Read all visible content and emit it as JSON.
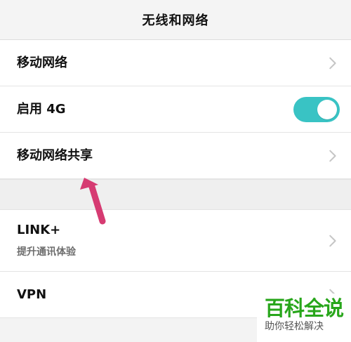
{
  "header": {
    "title": "无线和网络"
  },
  "items": [
    {
      "label": "移动网络",
      "control": "chevron-right-icon"
    },
    {
      "label": "启用 4G",
      "control": "toggle",
      "toggle_on": true,
      "toggle_color": "#39c3c4"
    },
    {
      "label": "移动网络共享",
      "control": "chevron-right-icon"
    },
    {
      "label": "LINK+",
      "sublabel": "提升通讯体验",
      "control": "chevron-right-icon"
    },
    {
      "label": "VPN",
      "control": "chevron-right-icon"
    }
  ],
  "annotation": {
    "color": "#d63b72",
    "icon": "pointer-arrow-icon"
  },
  "watermark": {
    "title": "百科全说",
    "subtitle": "助你轻松解决"
  }
}
